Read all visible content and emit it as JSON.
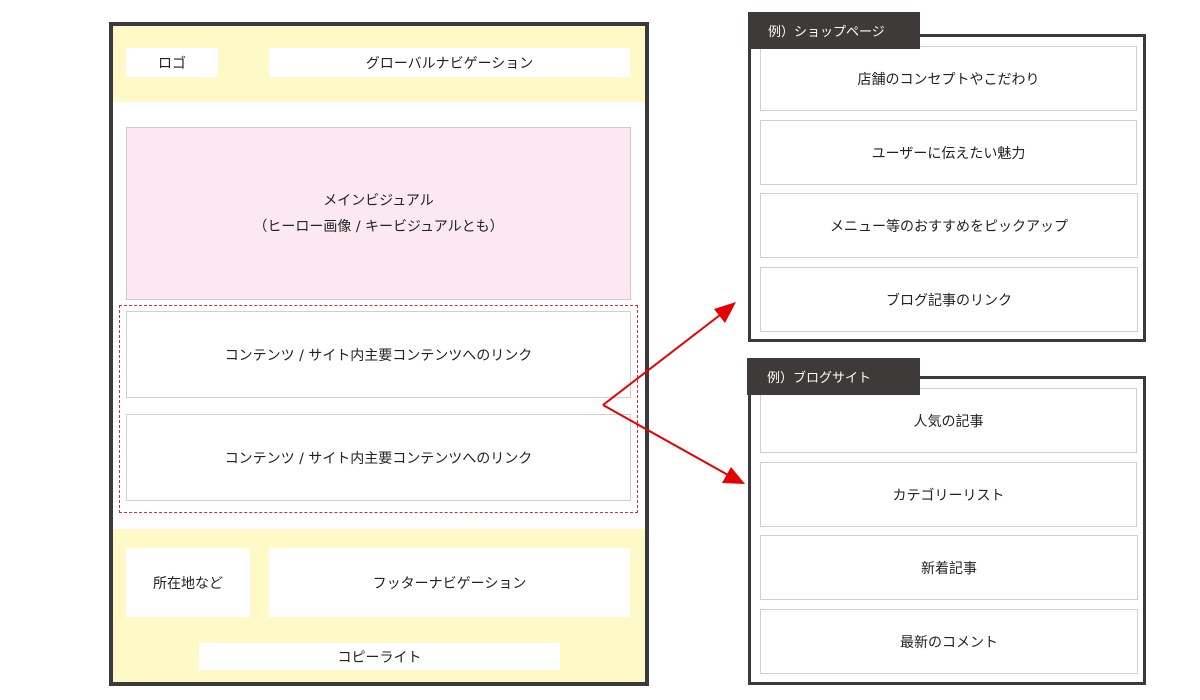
{
  "wireframe": {
    "header": {
      "logo": "ロゴ",
      "global_nav": "グローバルナビゲーション"
    },
    "main_visual": {
      "title": "メインビジュアル",
      "subtitle": "（ヒーロー画像 / キービジュアルとも）"
    },
    "content_links": [
      "コンテンツ / サイト内主要コンテンツへのリンク",
      "コンテンツ / サイト内主要コンテンツへのリンク"
    ],
    "footer": {
      "location": "所在地など",
      "footer_nav": "フッターナビゲーション",
      "copyright": "コピーライト"
    }
  },
  "examples": {
    "shop": {
      "tab": "例）ショップページ",
      "items": [
        "店舗のコンセプトやこだわり",
        "ユーザーに伝えたい魅力",
        "メニュー等のおすすめをピックアップ",
        "ブログ記事のリンク"
      ]
    },
    "blog": {
      "tab": "例）ブログサイト",
      "items": [
        "人気の記事",
        "カテゴリーリスト",
        "新着記事",
        "最新のコメント"
      ]
    }
  },
  "colors": {
    "frame": "#3a3a3a",
    "header_footer_bg": "#fff9c7",
    "main_visual_bg": "#fce8f0",
    "dashed_border": "#d43030",
    "arrow": "#e60000",
    "tab_bg": "#3d3a39"
  }
}
